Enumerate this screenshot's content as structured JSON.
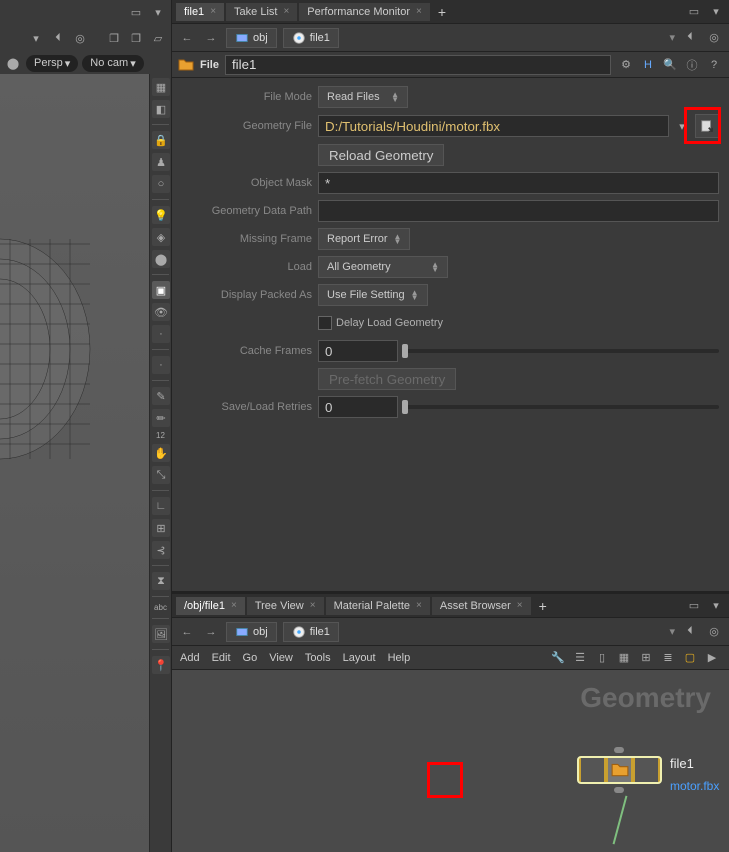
{
  "tabs_top": [
    {
      "label": "file1",
      "active": true
    },
    {
      "label": "Take List",
      "active": false
    },
    {
      "label": "Performance Monitor",
      "active": false
    }
  ],
  "tabs_bottom": [
    {
      "label": "/obj/file1",
      "active": true
    },
    {
      "label": "Tree View",
      "active": false
    },
    {
      "label": "Material Palette",
      "active": false
    },
    {
      "label": "Asset Browser",
      "active": false
    }
  ],
  "breadcrumb": {
    "level1": "obj",
    "level2": "file1"
  },
  "view_dropdowns": {
    "persp": "Persp",
    "cam": "No cam"
  },
  "node": {
    "type": "File",
    "name": "file1"
  },
  "params": {
    "file_mode": {
      "label": "File Mode",
      "value": "Read Files"
    },
    "geometry_file": {
      "label": "Geometry File",
      "value": "D:/Tutorials/Houdini/motor.fbx"
    },
    "reload": {
      "label": "Reload Geometry"
    },
    "object_mask": {
      "label": "Object Mask",
      "value": "*"
    },
    "geo_data_path": {
      "label": "Geometry Data Path",
      "value": ""
    },
    "missing_frame": {
      "label": "Missing Frame",
      "value": "Report Error"
    },
    "load": {
      "label": "Load",
      "value": "All Geometry"
    },
    "display_packed": {
      "label": "Display Packed As",
      "value": "Use File Setting"
    },
    "delay_load": {
      "label": "Delay Load Geometry"
    },
    "cache_frames": {
      "label": "Cache Frames",
      "value": "0"
    },
    "prefetch": {
      "label": "Pre-fetch Geometry"
    },
    "retries": {
      "label": "Save/Load Retries",
      "value": "0"
    }
  },
  "network": {
    "title": "Geometry",
    "node_label": "file1",
    "node_sublabel": "motor.fbx",
    "menu": [
      "Add",
      "Edit",
      "Go",
      "View",
      "Tools",
      "Layout",
      "Help"
    ]
  },
  "shelf_label_abc": "abc",
  "shelf_label_12": "12"
}
